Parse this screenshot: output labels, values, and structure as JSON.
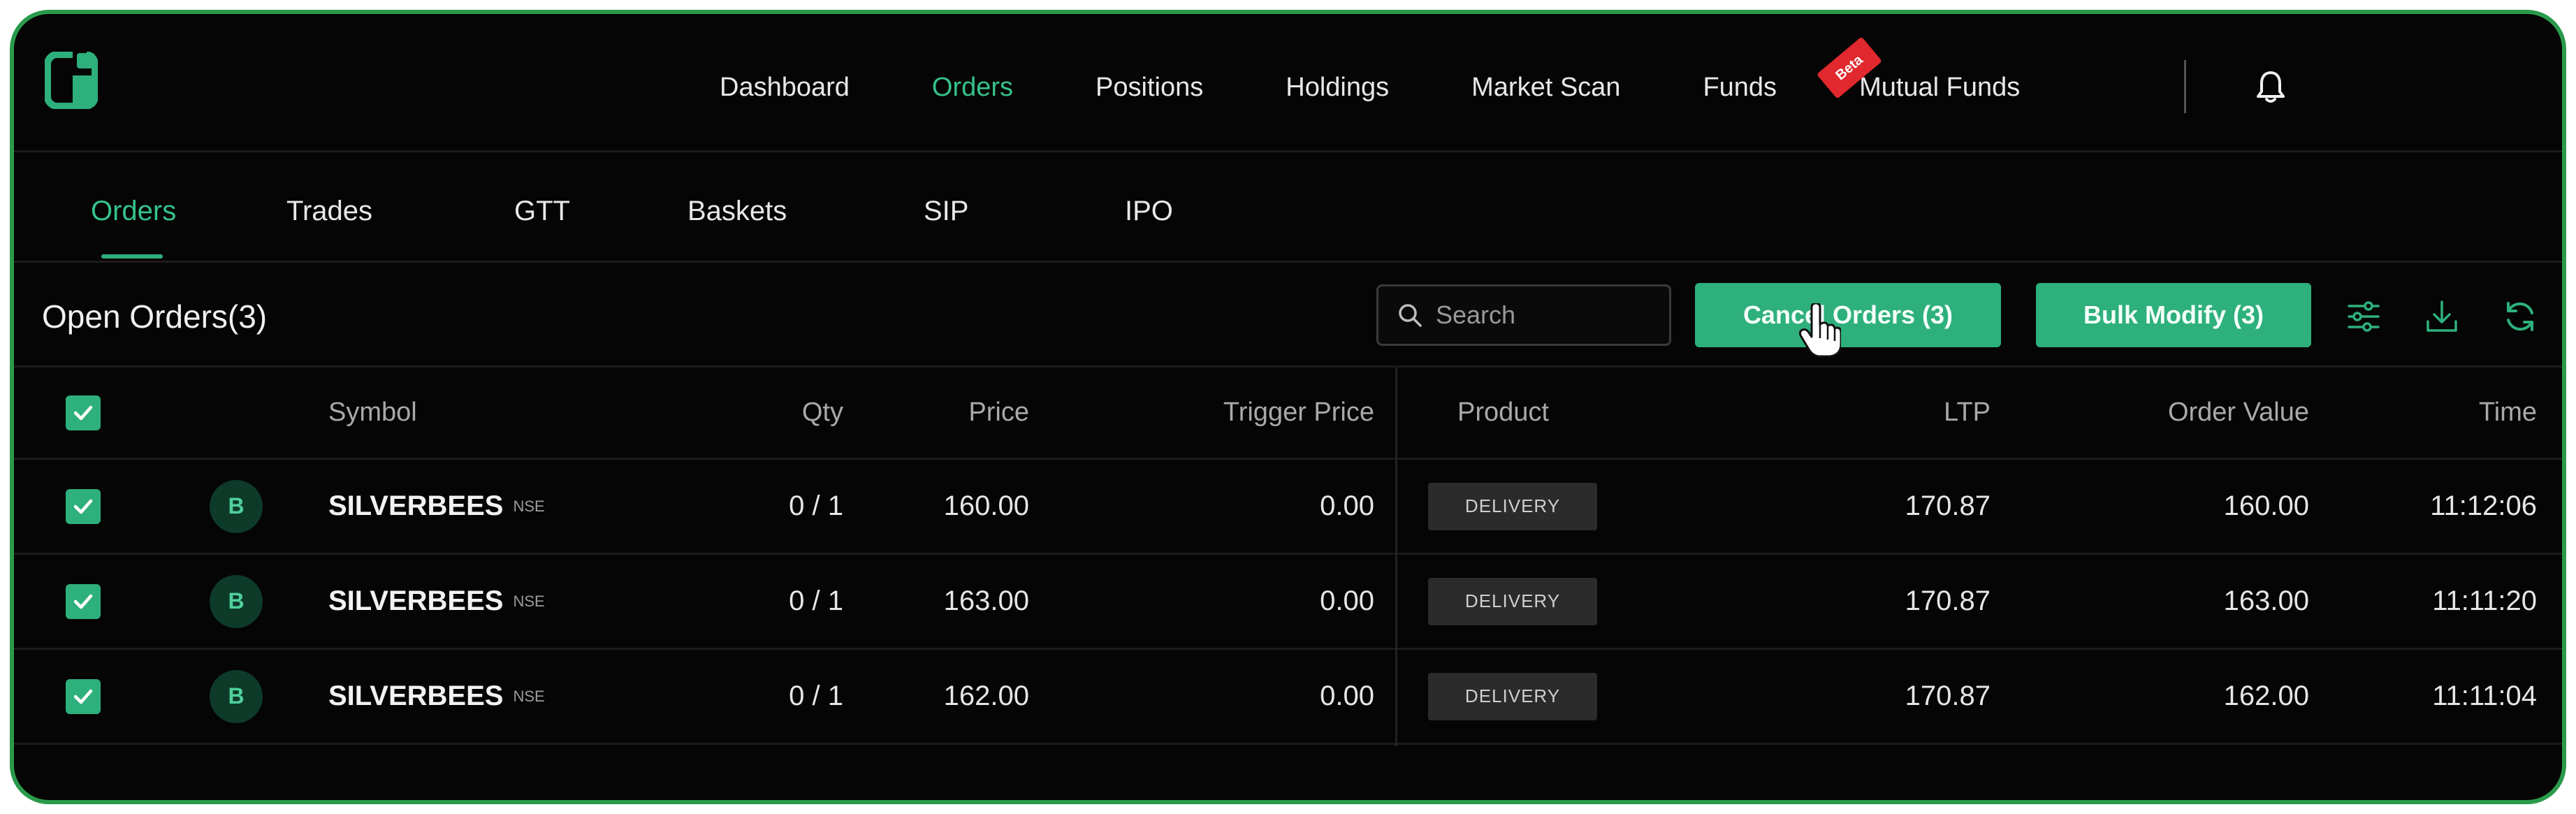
{
  "nav": {
    "items": [
      {
        "label": "Dashboard",
        "active": false
      },
      {
        "label": "Orders",
        "active": true
      },
      {
        "label": "Positions",
        "active": false
      },
      {
        "label": "Holdings",
        "active": false
      },
      {
        "label": "Market Scan",
        "active": false
      },
      {
        "label": "Funds",
        "active": false
      },
      {
        "label": "Mutual Funds",
        "active": false,
        "badge": "Beta"
      }
    ],
    "icons": [
      "app-logo",
      "bell-icon"
    ]
  },
  "subtabs": {
    "items": [
      {
        "label": "Orders",
        "active": true
      },
      {
        "label": "Trades",
        "active": false
      },
      {
        "label": "GTT",
        "active": false
      },
      {
        "label": "Baskets",
        "active": false
      },
      {
        "label": "SIP",
        "active": false
      },
      {
        "label": "IPO",
        "active": false
      }
    ]
  },
  "toolbar": {
    "title": "Open Orders(3)",
    "search_placeholder": "Search",
    "cancel_label": "Cancel Orders (3)",
    "bulk_label": "Bulk Modify (3)",
    "icons": [
      "filter-sliders-icon",
      "download-icon",
      "refresh-icon"
    ]
  },
  "table": {
    "columns": {
      "symbol": "Symbol",
      "qty": "Qty",
      "price": "Price",
      "trigger": "Trigger Price",
      "product": "Product",
      "ltp": "LTP",
      "order_value": "Order Value",
      "time": "Time"
    },
    "rows": [
      {
        "checked": true,
        "icon_letter": "B",
        "symbol": "SILVERBEES",
        "exchange": "NSE",
        "qty": "0 / 1",
        "price": "160.00",
        "trigger": "0.00",
        "product": "DELIVERY",
        "ltp": "170.87",
        "order_value": "160.00",
        "time": "11:12:06"
      },
      {
        "checked": true,
        "icon_letter": "B",
        "symbol": "SILVERBEES",
        "exchange": "NSE",
        "qty": "0 / 1",
        "price": "163.00",
        "trigger": "0.00",
        "product": "DELIVERY",
        "ltp": "170.87",
        "order_value": "163.00",
        "time": "11:11:20"
      },
      {
        "checked": true,
        "icon_letter": "B",
        "symbol": "SILVERBEES",
        "exchange": "NSE",
        "qty": "0 / 1",
        "price": "162.00",
        "trigger": "0.00",
        "product": "DELIVERY",
        "ltp": "170.87",
        "order_value": "162.00",
        "time": "11:11:04"
      }
    ]
  },
  "colors": {
    "accent": "#2eb07c",
    "active_text": "#36c28c",
    "border": "#2a9a4a",
    "background": "#050505",
    "beta_badge": "#e0282e"
  }
}
